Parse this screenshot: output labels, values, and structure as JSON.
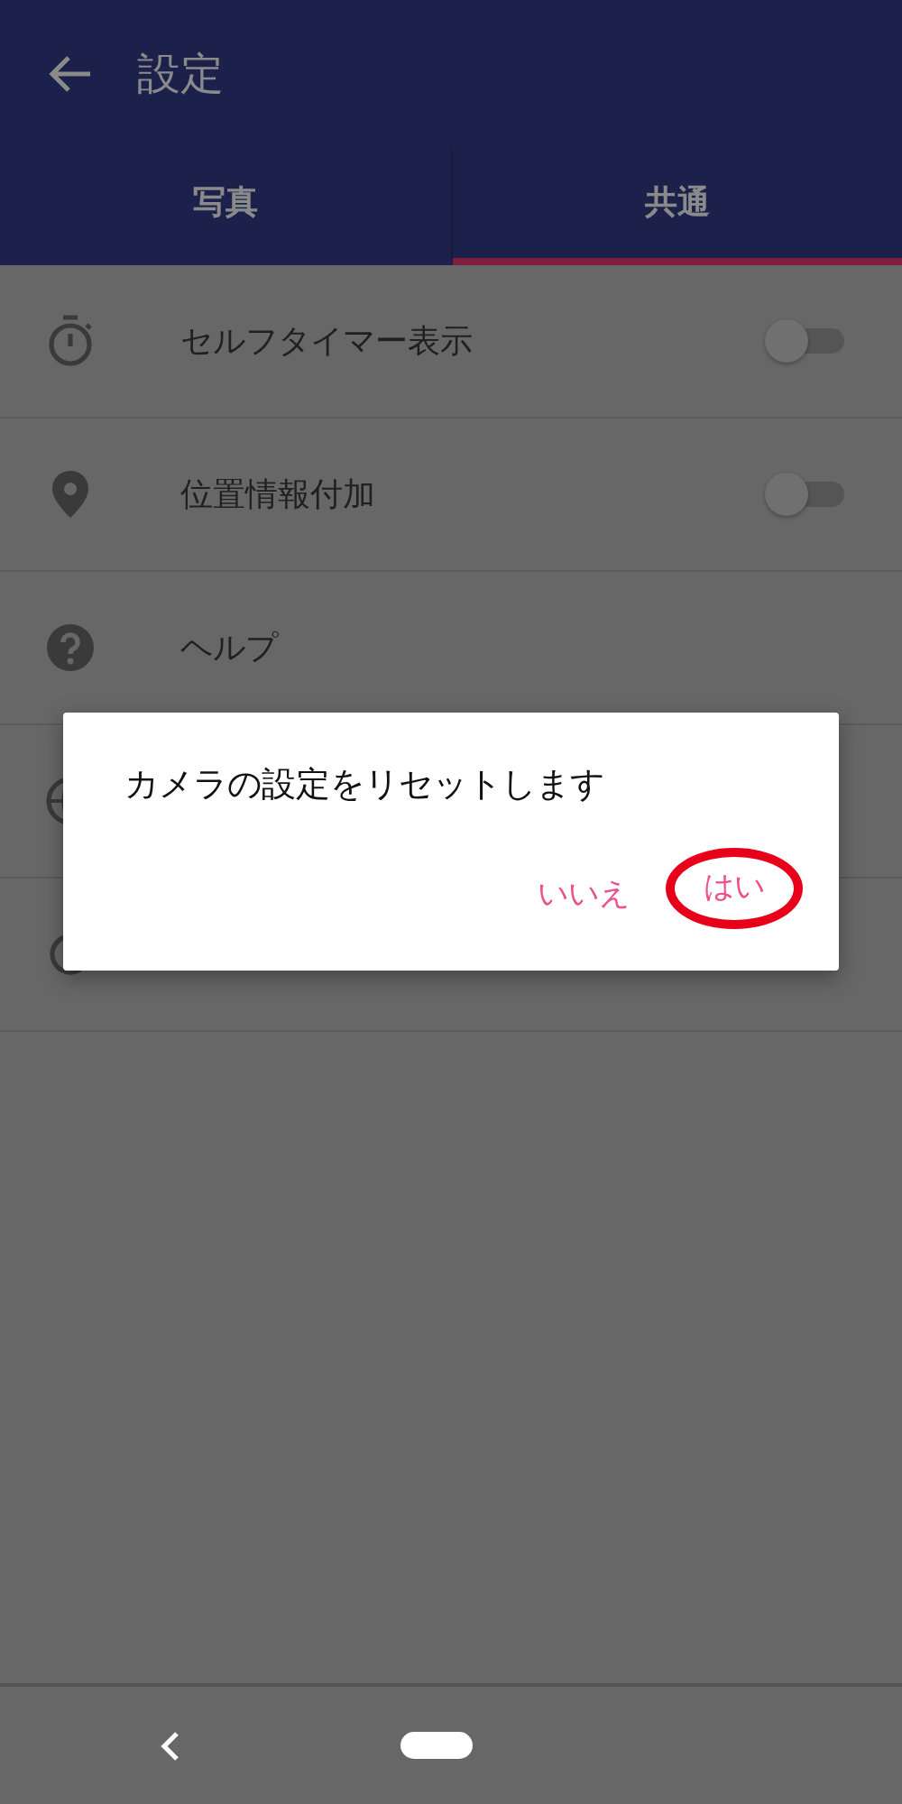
{
  "app_bar": {
    "title": "設定"
  },
  "tabs": [
    {
      "label": "写真",
      "selected": false
    },
    {
      "label": "共通",
      "selected": true
    }
  ],
  "settings": [
    {
      "kind": "toggle",
      "label": "セルフタイマー表示",
      "on": false
    },
    {
      "kind": "toggle",
      "label": "位置情報付加",
      "on": false
    },
    {
      "kind": "link",
      "label": "ヘルプ"
    },
    {
      "kind": "link"
    },
    {
      "kind": "link"
    }
  ],
  "dialog": {
    "message": "カメラの設定をリセットします",
    "buttons": [
      {
        "label": "いいえ",
        "highlighted": false
      },
      {
        "label": "はい",
        "highlighted": true
      }
    ]
  }
}
